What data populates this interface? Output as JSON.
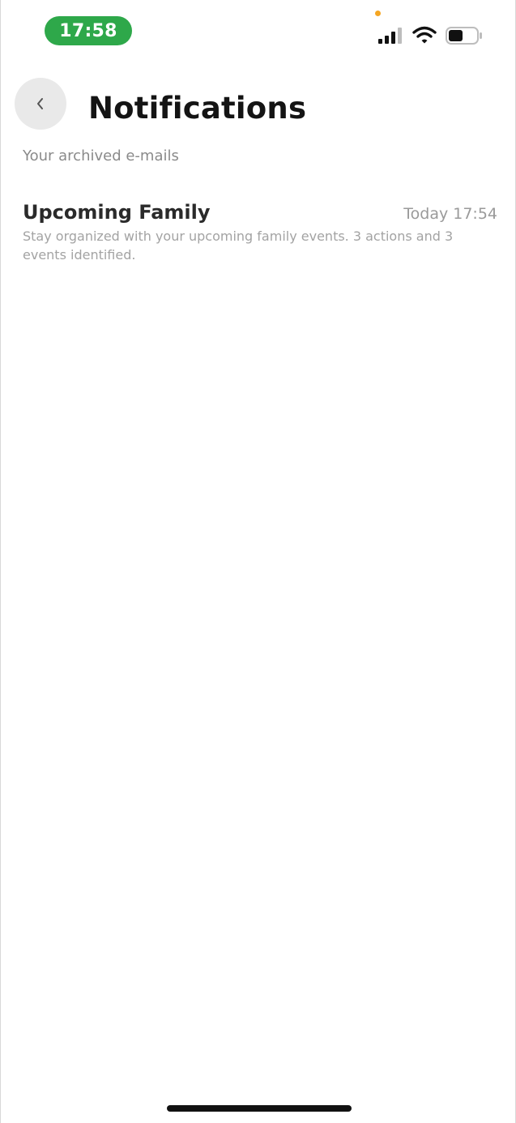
{
  "status_bar": {
    "time": "17:58",
    "time_pill_color": "#2ea84a",
    "privacy_indicator_color": "#f5a623",
    "icons": [
      "signal-icon",
      "wifi-icon",
      "battery-icon"
    ]
  },
  "header": {
    "back_icon": "chevron-left-icon",
    "title": "Notifications",
    "subtitle": "Your archived e-mails"
  },
  "notifications": [
    {
      "title": "Upcoming Family",
      "timestamp": "Today 17:54",
      "preview": "Stay organized with your upcoming family events. 3 actions and 3 events identified."
    }
  ]
}
